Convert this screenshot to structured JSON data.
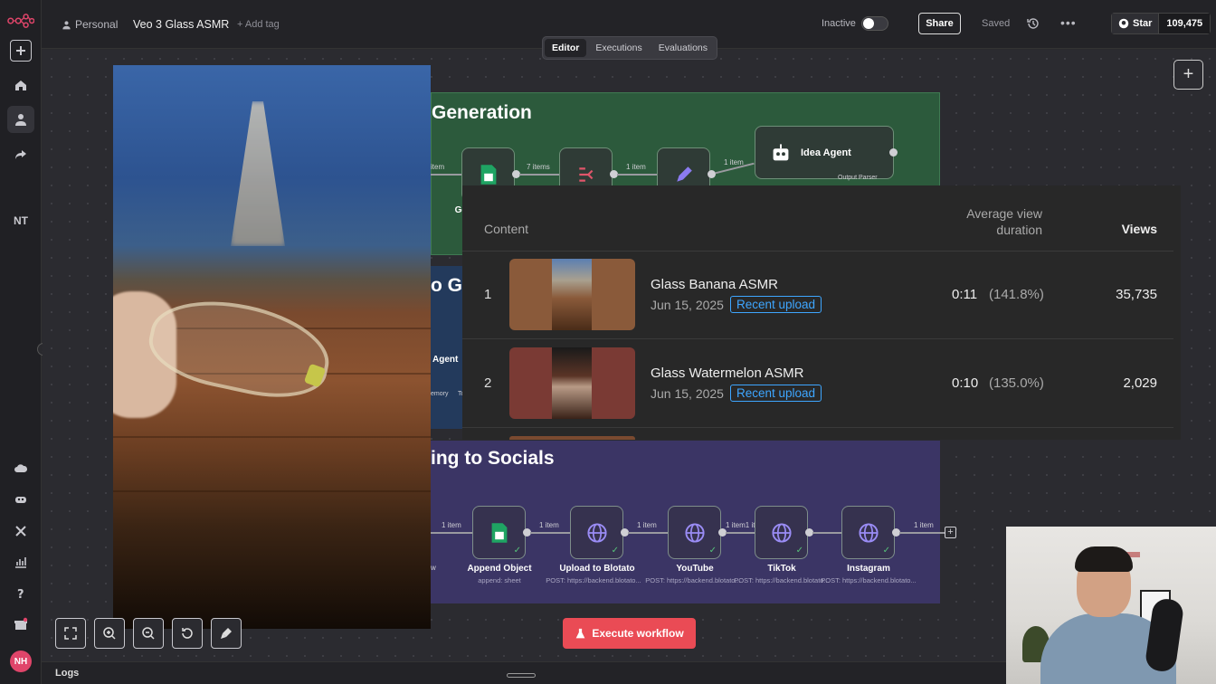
{
  "sidebar": {
    "logo": "n8n-logo-icon",
    "items": [
      "plus-icon",
      "home-icon",
      "user-icon",
      "share-icon"
    ],
    "initials": "NT",
    "bottom_items": [
      "cloud-icon",
      "templates-icon",
      "variables-icon",
      "insights-icon",
      "help-icon",
      "gift-icon"
    ],
    "avatar": "NH"
  },
  "topbar": {
    "workspace": "Personal",
    "workflow_name": "Veo 3 Glass ASMR",
    "add_tag": "+ Add tag",
    "status": "Inactive",
    "share": "Share",
    "saved": "Saved",
    "github_star": "Star",
    "github_count": "109,475"
  },
  "tabs": [
    {
      "label": "Editor",
      "active": true
    },
    {
      "label": "Executions",
      "active": false
    },
    {
      "label": "Evaluations",
      "active": false
    }
  ],
  "canvas": {
    "green_section_title": "Generation",
    "blue_section_title": "o G",
    "purple_section_title": "ing to Socials",
    "top_row_labels": [
      "item",
      "7 items",
      "1 item",
      "1 item"
    ],
    "top_node_label": "Ge",
    "agent_node": "Idea Agent",
    "agent_sub": "Output Parser",
    "blue_agent": "Agent",
    "blue_memory": "emory",
    "blue_tool": "To",
    "bottom_row": [
      {
        "label": "Append Object",
        "sub": "append: sheet"
      },
      {
        "label": "Upload to Blotato",
        "sub": "POST: https://backend.blotato..."
      },
      {
        "label": "YouTube",
        "sub": "POST: https://backend.blotato..."
      },
      {
        "label": "TikTok",
        "sub": "POST: https://backend.blotato..."
      },
      {
        "label": "Instagram",
        "sub": "POST: https://backend.blotato..."
      }
    ],
    "bottom_edge_labels": [
      "1 item",
      "1 item",
      "1 item",
      "1 item1 item",
      "1 item"
    ],
    "bottom_left_label": "w"
  },
  "analytics": {
    "columns": {
      "content": "Content",
      "avg_duration": "Average view\nduration",
      "views": "Views"
    },
    "rows": [
      {
        "rank": "1",
        "title": "Glass Banana ASMR",
        "date": "Jun 15, 2025",
        "badge": "Recent upload",
        "duration": "0:11",
        "percent": "(141.8%)",
        "views": "35,735"
      },
      {
        "rank": "2",
        "title": "Glass Watermelon ASMR",
        "date": "Jun 15, 2025",
        "badge": "Recent upload",
        "duration": "0:10",
        "percent": "(135.0%)",
        "views": "2,029"
      }
    ]
  },
  "bottom": {
    "execute": "Execute workflow",
    "logs": "Logs"
  },
  "colors": {
    "accent": "#ea4b55",
    "green_sticky": "#2c5a3c",
    "purple_sticky": "#3b3565",
    "badge_blue": "#3ea6ff"
  }
}
